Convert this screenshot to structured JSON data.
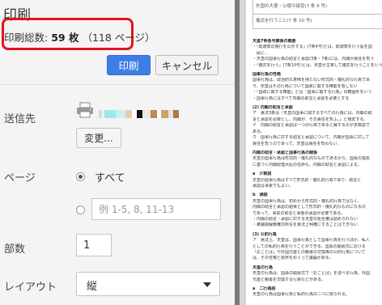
{
  "dialog": {
    "title": "印刷",
    "summary_label": "印刷総数:",
    "summary_sheets": "59 枚",
    "summary_pages": "（118 ページ）",
    "print_button": "印刷",
    "cancel_button": "キャンセル"
  },
  "destination": {
    "label": "送信先",
    "change_button": "変更...",
    "icon": "printer-icon"
  },
  "pages": {
    "label": "ページ",
    "all_label": "すべて",
    "selected": "all",
    "range_placeholder": "例 1-5, 8, 11-13"
  },
  "copies": {
    "label": "部数",
    "value": "1"
  },
  "layout": {
    "label": "レイアウト",
    "value": "縦"
  },
  "preview": {
    "table_rows": [
      "外国の大使・公使の接受(7 条 9 号)",
      "儀式を行うこと(7 条 10 号)"
    ],
    "lines": [
      {
        "t": "天皇7条各号関係の概要",
        "h": true
      },
      {
        "t": "・「総選挙の施行を公示する」(7条4号)とは、総選挙を行う旨を国",
        "h": false
      },
      {
        "t": "　民に..."
      },
      {
        "t": "・天皇の国事行為の助言と承認(3条・7条)には、内閣が責任を負う",
        "h": false
      },
      {
        "t": "・「儀式を行う」(7条10号)とは、天皇が主宰して儀式を行うことをいう",
        "h": false
      },
      {
        "t": "国事行為の性格",
        "h": true
      },
      {
        "t": "国事行為は、政治的な意味を持たない形式的・儀礼的な行為であ",
        "h": false
      },
      {
        "t": "り、天皇はその行為について国政に関する権能を有しない",
        "h": false
      },
      {
        "t": "・「国政に関する権能」とは「国事に関する行為」の範囲外をいう",
        "h": false
      },
      {
        "t": "・国事行為にはすべて内閣の助言と承認を必要とする",
        "h": false
      },
      {
        "t": "(2) 内閣の助言と承認",
        "h": true
      },
      {
        "t": "ア　憲法3条は「天皇の国事に関するすべての行為には、内閣の助",
        "h": false
      },
      {
        "t": "言と承認を必要とし、内閣が、その責任を負ふ。」と規定する。",
        "h": false
      },
      {
        "t": "イ　内閣の助言と承認は一つの行為であると解するのが多数説で",
        "h": false
      },
      {
        "t": "ある。",
        "h": false
      },
      {
        "t": "ウ　国事行為に対する助言と承認について、内閣が国会に対して",
        "h": false
      },
      {
        "t": "責任を負うのであって、天皇は責任を負わない。",
        "h": false
      },
      {
        "t": "内閣の助言・承認と国事行為の関係",
        "h": true
      },
      {
        "t": "天皇の国事行為は形式的・儀礼的なものであるから、国会の指名",
        "h": false
      },
      {
        "t": "に基づく内閣総理大臣の任命も、内閣の助言と承認による。",
        "h": false
      },
      {
        "t": "a　少数説",
        "h": true
      },
      {
        "t": "天皇の国事行為はすべて形式的・儀礼的行為であり、助言と",
        "h": false
      },
      {
        "t": "承認は事後でもよい。",
        "h": false
      },
      {
        "t": "b　通説",
        "h": true
      },
      {
        "t": "天皇の国事行為は、初めから形式的・儀礼的行為ではなく、",
        "h": false
      },
      {
        "t": "内閣の助言と承認の結果として形式的・儀礼的なものになるの",
        "h": false
      },
      {
        "t": "であって、事前の助言と事後の承認が必要である。",
        "h": false
      },
      {
        "t": "・内閣の助言・承認に対する天皇の拒否権は認められない",
        "h": false
      },
      {
        "t": "・衆議院解散権の所在を憲法上明確にすることはできない",
        "h": false
      },
      {
        "t": "(3) 公的行為",
        "h": true
      },
      {
        "t": "ア　憲法上、天皇は、国事行為として国事行為を行うほか、私人",
        "h": false
      },
      {
        "t": "としての私的行為を行うことができる。国会の開会式における",
        "h": false
      },
      {
        "t": "「おことば」や外国元首との親書の交換等の公的行為について",
        "h": false
      },
      {
        "t": "は、その性格と限界をめぐって議論がある。",
        "h": false
      },
      {
        "t": "天皇の行為",
        "h": true
      },
      {
        "t": "天皇の行為は、国会の開会式で「おことば」を述べる行為、外国",
        "h": false
      },
      {
        "t": "元首と親書を交換する行為などがある。",
        "h": false
      },
      {
        "t": "a　二行為説",
        "h": true
      },
      {
        "t": "天皇の行為は国事行為と私的行為の二つに限られる。",
        "h": false
      }
    ]
  },
  "colors": {
    "print_button": "#3f7de6",
    "highlight_box": "#e0141e",
    "panel_bg": "#f4f4f4",
    "preview_bg": "#d6d6d6"
  }
}
